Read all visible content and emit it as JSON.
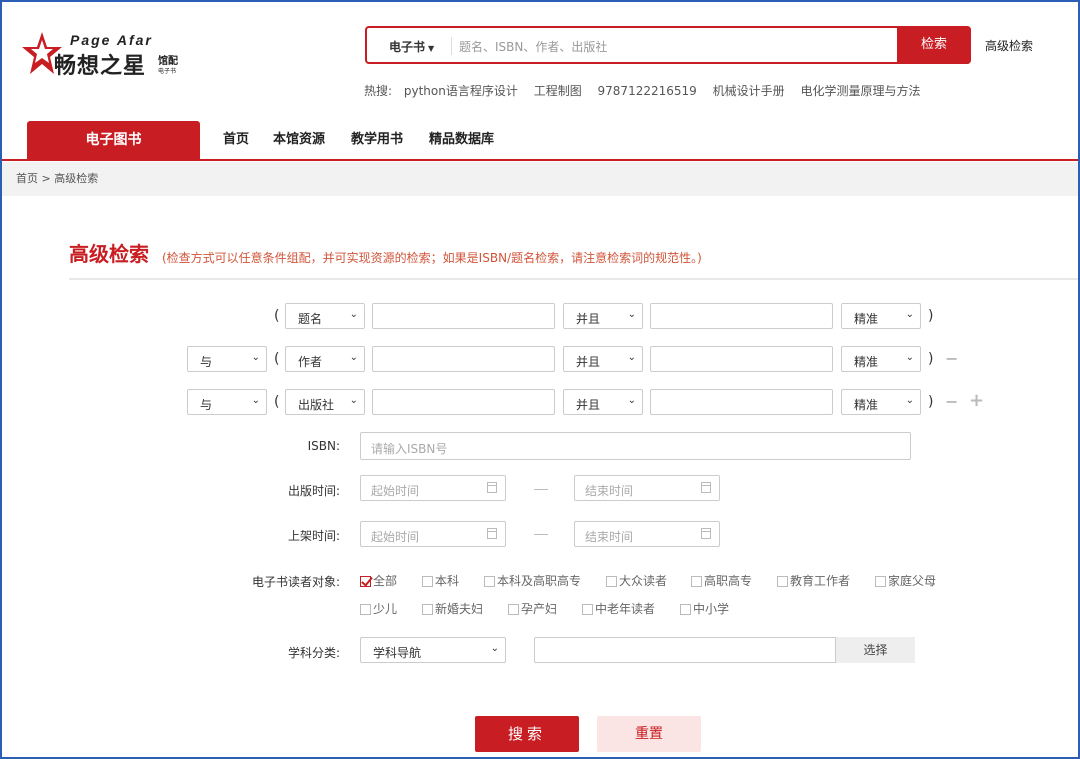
{
  "header": {
    "logo": {
      "brand_en": "Page Afar",
      "brand_cn": "畅想之星",
      "brand_sub1": "馆配",
      "brand_sub2": "电子书"
    },
    "search_type": "电子书",
    "search_placeholder": "题名、ISBN、作者、出版社",
    "search_button": "检索",
    "advanced_link": "高级检索",
    "hot_label": "热搜:",
    "hot_items": [
      "python语言程序设计",
      "工程制图",
      "9787122216519",
      "机械设计手册",
      "电化学测量原理与方法"
    ]
  },
  "nav": {
    "category": "电子图书",
    "items": [
      "首页",
      "本馆资源",
      "教学用书",
      "精品数据库"
    ]
  },
  "breadcrumb": "首页 > 高级检索",
  "page": {
    "title": "高级检索",
    "note": "(检查方式可以任意条件组配，并可实现资源的检索；如果是ISBN/题名检索，请注意检索词的规范性。)"
  },
  "rows": [
    {
      "logic": "",
      "field": "题名",
      "op": "并且",
      "match": "精准"
    },
    {
      "logic": "与",
      "field": "作者",
      "op": "并且",
      "match": "精准"
    },
    {
      "logic": "与",
      "field": "出版社",
      "op": "并且",
      "match": "精准"
    }
  ],
  "symbols": {
    "open": "(",
    "close": ")",
    "minus": "−",
    "plus": "+"
  },
  "isbn": {
    "label": "ISBN:",
    "placeholder": "请输入ISBN号"
  },
  "pub_time": {
    "label": "出版时间:",
    "start": "起始时间",
    "end": "结束时间"
  },
  "shelf_time": {
    "label": "上架时间:",
    "start": "起始时间",
    "end": "结束时间"
  },
  "audience": {
    "label": "电子书读者对象:",
    "options": [
      "全部",
      "本科",
      "本科及高职高专",
      "大众读者",
      "高职高专",
      "教育工作者",
      "家庭父母",
      "少儿",
      "新婚夫妇",
      "孕产妇",
      "中老年读者",
      "中小学"
    ],
    "checked": "全部"
  },
  "subject": {
    "label": "学科分类:",
    "select": "学科导航",
    "pick": "选择"
  },
  "buttons": {
    "search": "搜索",
    "reset": "重置"
  },
  "colors": {
    "accent": "#c81d22",
    "frame": "#2b5fb5"
  }
}
